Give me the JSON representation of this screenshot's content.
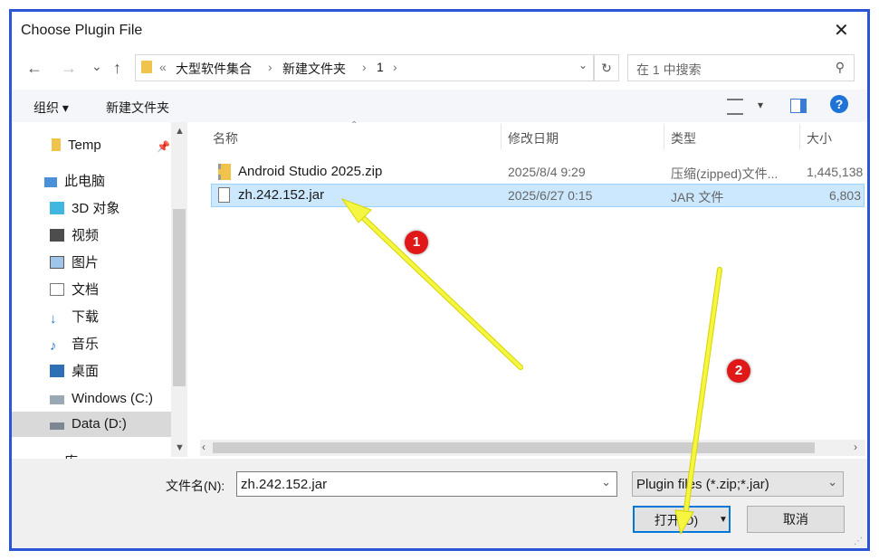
{
  "window": {
    "title": "Choose Plugin File",
    "close_glyph": "✕"
  },
  "nav": {
    "back": "←",
    "forward": "→",
    "recent": "⌄",
    "up": "↑"
  },
  "address": {
    "prefix": "«",
    "crumbs": [
      "大型软件集合",
      "新建文件夹",
      "1"
    ],
    "separator": "›"
  },
  "search": {
    "placeholder": "在 1 中搜索",
    "icon": "search-icon"
  },
  "toolbar": {
    "organize": "组织 ▾",
    "new_folder": "新建文件夹",
    "view_glyph": "▾",
    "help": "?"
  },
  "sidebar": {
    "items": [
      {
        "label": "Temp",
        "icon": "folder-icon"
      },
      {
        "label": "此电脑",
        "icon": "pc-icon"
      },
      {
        "label": "3D 对象",
        "icon": "cube-icon"
      },
      {
        "label": "视频",
        "icon": "video-icon"
      },
      {
        "label": "图片",
        "icon": "picture-icon"
      },
      {
        "label": "文档",
        "icon": "document-icon"
      },
      {
        "label": "下载",
        "icon": "download-icon"
      },
      {
        "label": "音乐",
        "icon": "music-icon"
      },
      {
        "label": "桌面",
        "icon": "desktop-icon"
      },
      {
        "label": "Windows (C:)",
        "icon": "drive-icon"
      },
      {
        "label": "Data (D:)",
        "icon": "drive-icon"
      },
      {
        "label": "库",
        "icon": "library-icon"
      }
    ]
  },
  "columns": {
    "name": "名称",
    "modified": "修改日期",
    "type": "类型",
    "size": "大小"
  },
  "files": [
    {
      "name": "Android Studio 2025.zip",
      "modified": "2025/8/4 9:29",
      "type": "压缩(zipped)文件...",
      "size": "1,445,138"
    },
    {
      "name": "zh.242.152.jar",
      "modified": "2025/6/27 0:15",
      "type": "JAR 文件",
      "size": "6,803"
    }
  ],
  "footer": {
    "filename_label": "文件名(N):",
    "filename_value": "zh.242.152.jar",
    "filter_value": "Plugin files (*.zip;*.jar)",
    "open_label": "打开(O)",
    "cancel_label": "取消"
  },
  "annotations": {
    "badge1": "1",
    "badge2": "2"
  },
  "colors": {
    "frame": "#2b55d6",
    "selection": "#cce8ff",
    "arrow": "#f5f542",
    "badge": "#e01818",
    "help": "#1e73d6"
  }
}
